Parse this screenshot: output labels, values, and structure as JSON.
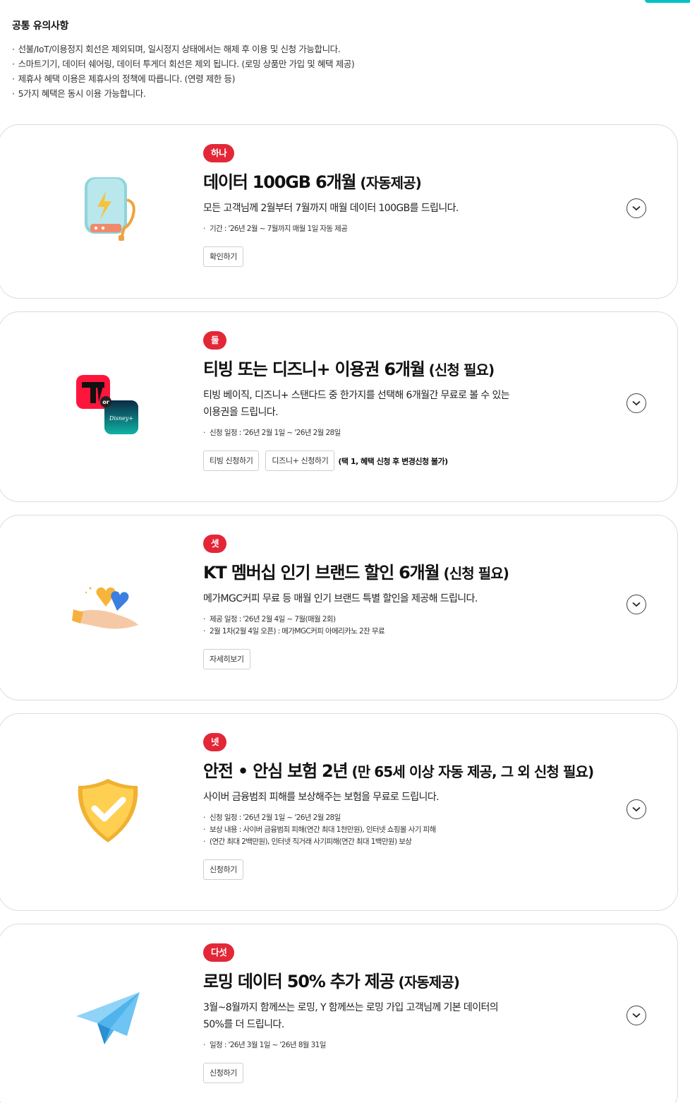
{
  "notice": {
    "title": "공통 유의사항",
    "items": [
      "선불/IoT/이용정지 회선은 제외되며, 일시정지 상태에서는 해제 후 이용 및 신청 가능합니다.",
      "스마트기기, 데이터 쉐어링, 데이터 투게더 회선은 제외 됩니다. (로밍 상품만 가입 및 혜택 제공)",
      "제휴사 혜택 이용은 제휴사의 정책에 따릅니다. (연령 제한 등)",
      "5가지 혜택은 동시 이용 가능합니다."
    ]
  },
  "benefits": [
    {
      "badge": "하나",
      "title_plain": "데이터 ",
      "title_strong": "100GB 6개월",
      "title_note": " (자동제공)",
      "description": "모든 고객님께 2월부터 7월까지 매월 데이터 100GB를 드립니다.",
      "details": [
        "기간 : '26년 2월 ~ 7월까지 매월 1일 자동 제공"
      ],
      "buttons": [
        "확인하기"
      ],
      "icon": "battery-icon"
    },
    {
      "badge": "둘",
      "title_plain": "티빙 또는 디즈니+ ",
      "title_strong": "이용권 6개월",
      "title_note": " (신청 필요)",
      "description_line1": "티빙 베이직, 디즈니+ 스탠다드 중 한가지를 선택해 6개월간 무료로 볼 수 있는",
      "description_line2": "이용권을 드립니다.",
      "details": [
        "신청 일정 : '26년 2월 1일 ~ '26년 2월 28일"
      ],
      "buttons": [
        "티빙 신청하기",
        "디즈니+ 신청하기"
      ],
      "button_note": "(택 1, 혜택 신청 후 변경신청 불가)",
      "icon": "tving-disney-icon",
      "logo_or": "or",
      "logo_disney": "Disney+"
    },
    {
      "badge": "셋",
      "title_plain": "KT 멤버십 ",
      "title_strong": "인기 브랜드 할인 6개월",
      "title_note": " (신청 필요)",
      "description": "메가MGC커피 무료 등 매월 인기 브랜드 특별 할인을 제공해 드립니다.",
      "details": [
        "제공 일정 : '26년 2월 4일 ~ 7월(매월 2회)",
        "2월 1차(2월 4일 오픈) : 메가MGC커피 아메리카노 2잔 무료"
      ],
      "buttons": [
        "자세히보기"
      ],
      "icon": "hand-hearts-icon"
    },
    {
      "badge": "넷",
      "title_strong": "안전 • 안심 보험 2년",
      "title_note": " (만 65세 이상 자동 제공, 그 외 신청 필요)",
      "description": "사이버 금융범죄 피해를 보상해주는 보험을 무료로 드립니다.",
      "details": [
        "신청 일정 : '26년 2월 1일 ~ '26년 2월 28일",
        "보상 내용 : 사이버 금융범죄 피해(연간 최대 1천만원), 인터넷 쇼핑몰 사기 피해"
      ],
      "details_cont": "(연간 최대 2백만원), 인터넷 직거래 사기피해(연간 최대 1백만원) 보상",
      "buttons": [
        "신청하기"
      ],
      "icon": "shield-check-icon"
    },
    {
      "badge": "다섯",
      "title_plain": "로밍 데이터 ",
      "title_strong": "50% 추가 제공",
      "title_note": " (자동제공)",
      "description_line1": "3월~8월까지 함께쓰는 로밍, Y 함께쓰는 로밍 가입 고객님께 기본 데이터의",
      "description_line2": "50%를 더 드립니다.",
      "details": [
        "일정 : '26년 3월 1일 ~ '26년 8월 31일"
      ],
      "buttons": [
        "신청하기"
      ],
      "icon": "paper-plane-icon"
    }
  ],
  "colors": {
    "badge": "#e32737",
    "accent": "#00c2c7"
  }
}
